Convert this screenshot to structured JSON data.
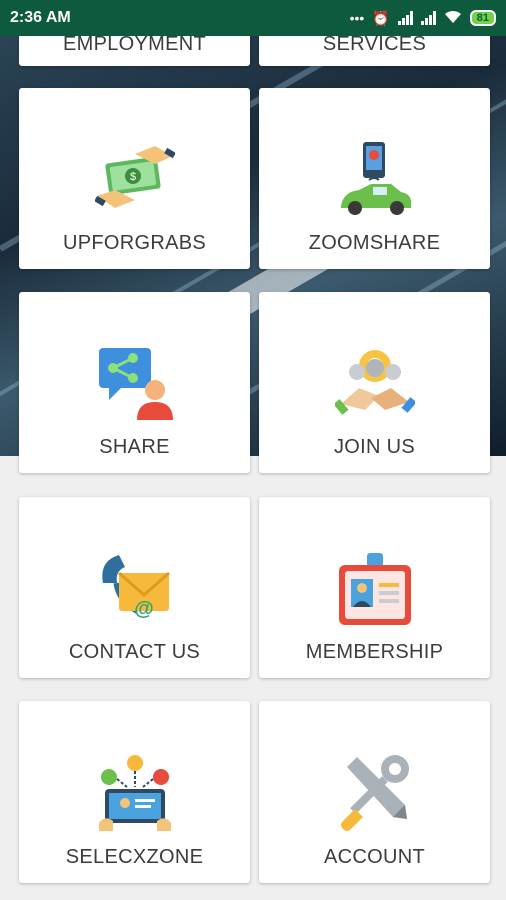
{
  "status": {
    "time": "2:36 AM",
    "battery": "81",
    "dots": "•••"
  },
  "tiles": [
    {
      "label": "EMPLOYMENT"
    },
    {
      "label": "SERVICES"
    },
    {
      "label": "UPFORGRABS"
    },
    {
      "label": "ZOOMSHARE"
    },
    {
      "label": "SHARE"
    },
    {
      "label": "JOIN US"
    },
    {
      "label": "CONTACT US"
    },
    {
      "label": "MEMBERSHIP"
    },
    {
      "label": "SELECXZONE"
    },
    {
      "label": "ACCOUNT"
    }
  ],
  "icons": [
    "money-hands-icon",
    "car-share-icon",
    "share-chat-icon",
    "handshake-gear-icon",
    "phone-mail-icon",
    "id-badge-icon",
    "network-tablet-icon",
    "tools-icon"
  ]
}
